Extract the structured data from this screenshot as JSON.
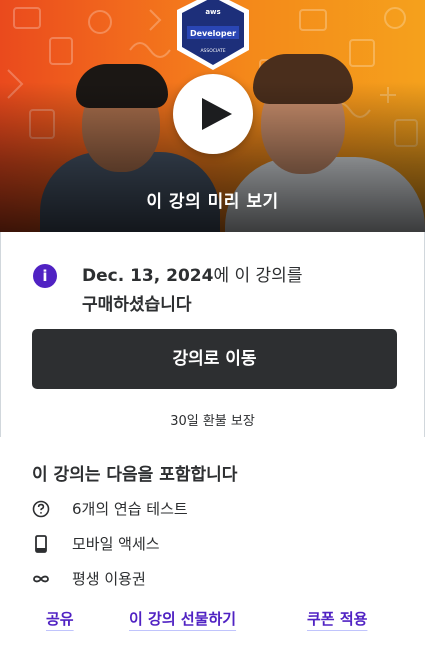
{
  "preview": {
    "label": "이 강의 미리 보기",
    "badge_text": "Developer",
    "badge_sub": "ASSOCIATE",
    "badge_top": "aws"
  },
  "purchase": {
    "date": "Dec. 13, 2024",
    "text_after_date": "에 이 강의를",
    "text_line2": "구매하셨습니다",
    "info_icon": "info-icon"
  },
  "go_button_label": "강의로 이동",
  "refund_label": "30일 환불 보장",
  "includes": {
    "title": "이 강의는 다음을 포함합니다",
    "items": [
      {
        "icon": "help-circle-icon",
        "label": "6개의 연습 테스트"
      },
      {
        "icon": "mobile-icon",
        "label": "모바일 액세스"
      },
      {
        "icon": "infinity-icon",
        "label": "평생 이용권"
      }
    ]
  },
  "actions": {
    "share": "공유",
    "gift": "이 강의 선물하기",
    "coupon": "쿠폰 적용"
  },
  "colors": {
    "accent": "#5022c3",
    "button_bg": "#2d2f31",
    "preview_orange": "#f26a1d"
  }
}
